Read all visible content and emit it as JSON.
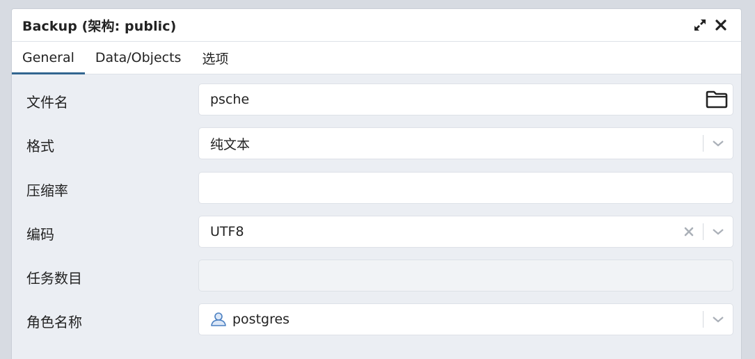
{
  "dialog": {
    "title": "Backup (架构: public)",
    "maximize_icon": "expand-icon",
    "close_icon": "close-icon"
  },
  "tabs": [
    {
      "label": "General",
      "active": true
    },
    {
      "label": "Data/Objects",
      "active": false
    },
    {
      "label": "选项",
      "active": false
    }
  ],
  "form": {
    "filename": {
      "label": "文件名",
      "value": "psche"
    },
    "format": {
      "label": "格式",
      "value": "纯文本"
    },
    "compression": {
      "label": "压缩率",
      "value": ""
    },
    "encoding": {
      "label": "编码",
      "value": "UTF8"
    },
    "jobs": {
      "label": "任务数目",
      "value": ""
    },
    "role": {
      "label": "角色名称",
      "value": "postgres"
    }
  },
  "colors": {
    "accent": "#326690",
    "background": "#ebeef3",
    "user_icon": "#4a7fc1"
  }
}
